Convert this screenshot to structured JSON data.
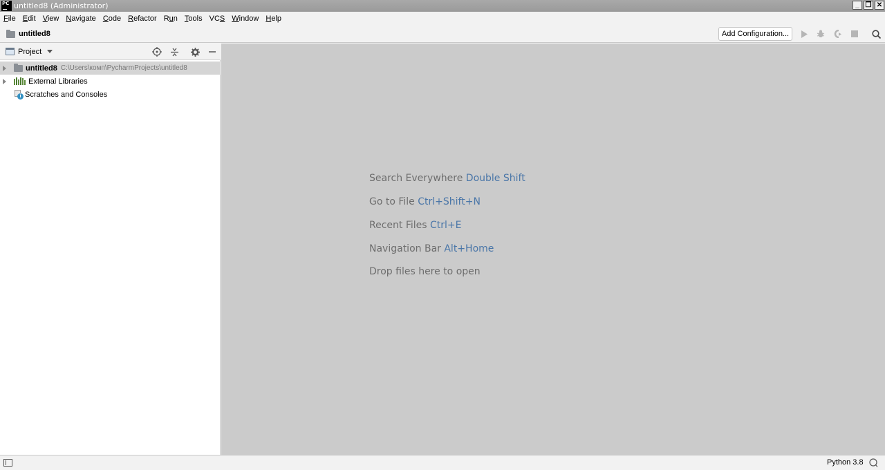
{
  "titlebar": {
    "logo_text": "PC",
    "title": "untitled8 (Administrator)",
    "minimize_label": "_",
    "restore_label": "❐",
    "close_label": "✕"
  },
  "menubar": {
    "items": [
      {
        "u": "F",
        "rest": "ile"
      },
      {
        "u": "E",
        "rest": "dit"
      },
      {
        "u": "V",
        "rest": "iew"
      },
      {
        "u": "N",
        "rest": "avigate"
      },
      {
        "u": "C",
        "rest": "ode"
      },
      {
        "u": "R",
        "rest": "efactor"
      },
      {
        "pre": "R",
        "u": "u",
        "rest": "n"
      },
      {
        "u": "T",
        "rest": "ools"
      },
      {
        "pre": "VC",
        "u": "S",
        "rest": ""
      },
      {
        "u": "W",
        "rest": "indow"
      },
      {
        "u": "H",
        "rest": "elp"
      }
    ]
  },
  "navbar": {
    "project_name": "untitled8",
    "add_configuration_label": "Add Configuration...",
    "icons": [
      "run-icon",
      "debug-icon",
      "coverage-icon",
      "stop-icon",
      "search-icon"
    ]
  },
  "project_panel": {
    "label": "Project",
    "icons": [
      "locate-icon",
      "collapse-all-icon",
      "settings-icon",
      "hide-icon"
    ],
    "tree": [
      {
        "name": "untitled8",
        "path": "C:\\Users\\комп\\PycharmProjects\\untitled8",
        "icon": "folder-icon",
        "selected": true
      },
      {
        "name": "External Libraries",
        "icon": "library-icon"
      },
      {
        "name": "Scratches and Consoles",
        "icon": "scratches-icon"
      }
    ]
  },
  "editor": {
    "hints": [
      {
        "text": "Search Everywhere",
        "key": "Double Shift"
      },
      {
        "text": "Go to File",
        "key": "Ctrl+Shift+N"
      },
      {
        "text": "Recent Files",
        "key": "Ctrl+E"
      },
      {
        "text": "Navigation Bar",
        "key": "Alt+Home"
      },
      {
        "text": "Drop files here to open",
        "key": ""
      }
    ]
  },
  "statusbar": {
    "interpreter": "Python 3.8"
  },
  "colors": {
    "editor_bg": "#cbcbcb",
    "hint_text": "#6d6d6d",
    "hint_key": "#4a76a8",
    "selection": "#d5d5d5"
  }
}
